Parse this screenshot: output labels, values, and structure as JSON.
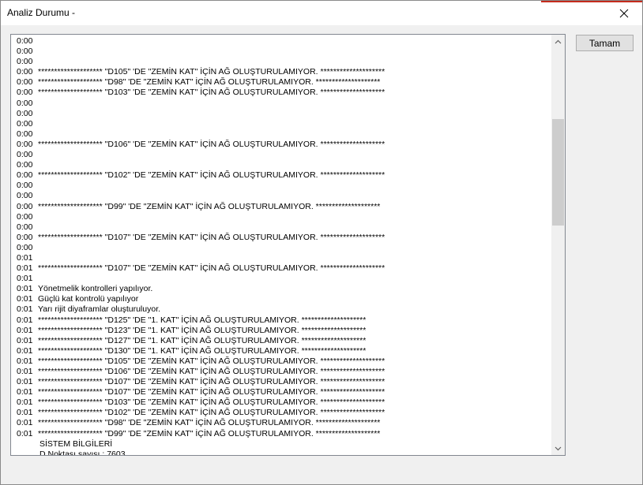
{
  "window": {
    "title": "Analiz Durumu -",
    "accent_color": "#c42b1c"
  },
  "buttons": {
    "ok_label": "Tamam"
  },
  "log": {
    "lines": [
      {
        "time": "0:00",
        "text": ""
      },
      {
        "time": "0:00",
        "text": ""
      },
      {
        "time": "0:00",
        "text": ""
      },
      {
        "time": "0:00",
        "text": "******************** \"D105\" 'DE \"ZEMİN KAT\" İÇİN AĞ OLUŞTURULAMIYOR. ********************"
      },
      {
        "time": "0:00",
        "text": "******************** \"D98\" 'DE \"ZEMİN KAT\" İÇİN AĞ OLUŞTURULAMIYOR. ********************"
      },
      {
        "time": "0:00",
        "text": "******************** \"D103\" 'DE \"ZEMİN KAT\" İÇİN AĞ OLUŞTURULAMIYOR. ********************"
      },
      {
        "time": "0:00",
        "text": ""
      },
      {
        "time": "0:00",
        "text": ""
      },
      {
        "time": "0:00",
        "text": ""
      },
      {
        "time": "0:00",
        "text": ""
      },
      {
        "time": "0:00",
        "text": "******************** \"D106\" 'DE \"ZEMİN KAT\" İÇİN AĞ OLUŞTURULAMIYOR. ********************"
      },
      {
        "time": "0:00",
        "text": ""
      },
      {
        "time": "0:00",
        "text": ""
      },
      {
        "time": "0:00",
        "text": "******************** \"D102\" 'DE \"ZEMİN KAT\" İÇİN AĞ OLUŞTURULAMIYOR. ********************"
      },
      {
        "time": "0:00",
        "text": ""
      },
      {
        "time": "0:00",
        "text": ""
      },
      {
        "time": "0:00",
        "text": "******************** \"D99\" 'DE \"ZEMİN KAT\" İÇİN AĞ OLUŞTURULAMIYOR. ********************"
      },
      {
        "time": "0:00",
        "text": ""
      },
      {
        "time": "0:00",
        "text": ""
      },
      {
        "time": "0:00",
        "text": "******************** \"D107\" 'DE \"ZEMİN KAT\" İÇİN AĞ OLUŞTURULAMIYOR. ********************"
      },
      {
        "time": "0:00",
        "text": ""
      },
      {
        "time": "0:01",
        "text": ""
      },
      {
        "time": "0:01",
        "text": "******************** \"D107\" 'DE \"ZEMİN KAT\" İÇİN AĞ OLUŞTURULAMIYOR. ********************"
      },
      {
        "time": "0:01",
        "text": ""
      },
      {
        "time": "0:01",
        "text": "Yönetmelik kontrolleri yapılıyor."
      },
      {
        "time": "0:01",
        "text": "Güçlü kat kontrolü yapılıyor"
      },
      {
        "time": "0:01",
        "text": "Yarı rijit diyaframlar oluşturuluyor."
      },
      {
        "time": "0:01",
        "text": "******************** \"D125\" 'DE \"1. KAT\" İÇİN AĞ OLUŞTURULAMIYOR. ********************"
      },
      {
        "time": "0:01",
        "text": "******************** \"D123\" 'DE \"1. KAT\" İÇİN AĞ OLUŞTURULAMIYOR. ********************"
      },
      {
        "time": "0:01",
        "text": "******************** \"D127\" 'DE \"1. KAT\" İÇİN AĞ OLUŞTURULAMIYOR. ********************"
      },
      {
        "time": "0:01",
        "text": "******************** \"D130\" 'DE \"1. KAT\" İÇİN AĞ OLUŞTURULAMIYOR. ********************"
      },
      {
        "time": "0:01",
        "text": "******************** \"D105\" 'DE \"ZEMİN KAT\" İÇİN AĞ OLUŞTURULAMIYOR. ********************"
      },
      {
        "time": "0:01",
        "text": "******************** \"D106\" 'DE \"ZEMİN KAT\" İÇİN AĞ OLUŞTURULAMIYOR. ********************"
      },
      {
        "time": "0:01",
        "text": "******************** \"D107\" 'DE \"ZEMİN KAT\" İÇİN AĞ OLUŞTURULAMIYOR. ********************"
      },
      {
        "time": "0:01",
        "text": "******************** \"D107\" 'DE \"ZEMİN KAT\" İÇİN AĞ OLUŞTURULAMIYOR. ********************"
      },
      {
        "time": "0:01",
        "text": "******************** \"D103\" 'DE \"ZEMİN KAT\" İÇİN AĞ OLUŞTURULAMIYOR. ********************"
      },
      {
        "time": "0:01",
        "text": "******************** \"D102\" 'DE \"ZEMİN KAT\" İÇİN AĞ OLUŞTURULAMIYOR. ********************"
      },
      {
        "time": "0:01",
        "text": "******************** \"D98\" 'DE \"ZEMİN KAT\" İÇİN AĞ OLUŞTURULAMIYOR. ********************"
      },
      {
        "time": "0:01",
        "text": "******************** \"D99\" 'DE \"ZEMİN KAT\" İÇİN AĞ OLUŞTURULAMIYOR. ********************"
      },
      {
        "time": "",
        "text": "SİSTEM BİLGİLERİ"
      },
      {
        "time": "",
        "text": "D.Noktası sayısı : 7603"
      }
    ]
  },
  "scroll": {
    "thumb_position": 0.18,
    "thumb_fraction": 0.27
  },
  "icons": {
    "close": "close-icon",
    "scroll_up": "chevron-up-icon",
    "scroll_down": "chevron-down-icon"
  }
}
